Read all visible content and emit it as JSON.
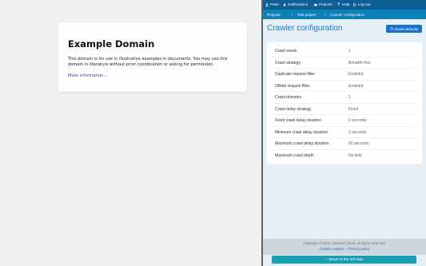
{
  "example_page": {
    "heading": "Example Domain",
    "body": "This domain is for use in illustrative examples in documents. You may use this domain in literature without prior coordination or asking for permission.",
    "link": "More information..."
  },
  "topbar": {
    "user": "Peter",
    "notifications": "Notifications",
    "projects": "Projects",
    "help": "Help",
    "logout": "Log out"
  },
  "breadcrumb": {
    "items": [
      "Projects",
      "Test project",
      "Crawler configuration"
    ]
  },
  "page_title": "Crawler configuration",
  "reset_button": "Reset defaults",
  "config": [
    {
      "label": "Crawl seeds",
      "value": "1"
    },
    {
      "label": "Crawl strategy",
      "value": "Breadth-first"
    },
    {
      "label": "Duplicate request filter",
      "value": "Enabled"
    },
    {
      "label": "Offsite request filter",
      "value": "Enabled"
    },
    {
      "label": "Crawl domains",
      "value": "1"
    },
    {
      "label": "Crawl delay strategy",
      "value": "Fixed"
    },
    {
      "label": "Fixed crawl delay duration",
      "value": "0 seconds"
    },
    {
      "label": "Minimum crawl delay duration",
      "value": "1 seconds"
    },
    {
      "label": "Maximum crawl delay duration",
      "value": "60 seconds"
    },
    {
      "label": "Maximum crawl depth",
      "value": "No limit"
    }
  ],
  "footer": {
    "copyright": "Copyright © 2020, Sentinel Cloud. All rights reserved.",
    "contact": "Contact support",
    "privacy": "Privacy policy"
  },
  "move_button": "Move to the left side",
  "colors": {
    "topbar": "#0d5f96",
    "crumbbar": "#0c7fb6",
    "accent": "#1180c0",
    "move_button": "#1a9db0"
  }
}
